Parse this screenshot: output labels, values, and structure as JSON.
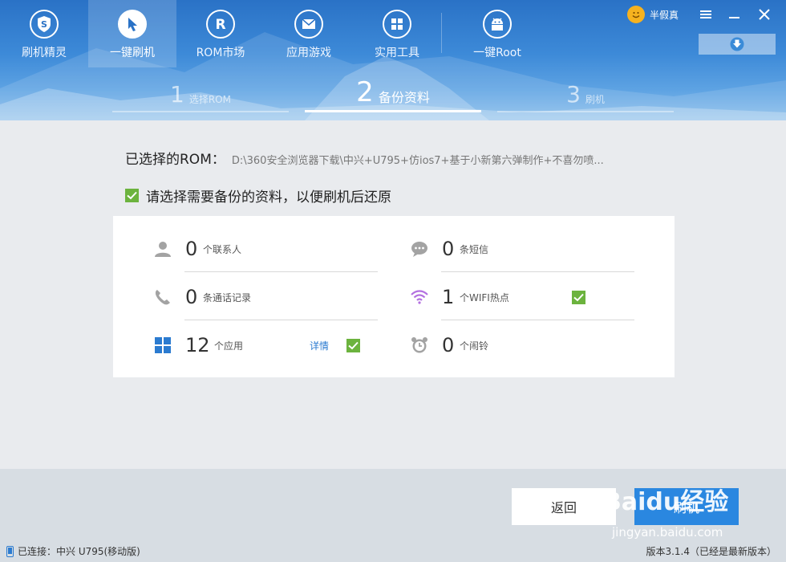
{
  "nav": {
    "items": [
      {
        "label": "刷机精灵",
        "icon": "shield-s-icon"
      },
      {
        "label": "一键刷机",
        "icon": "cursor-icon"
      },
      {
        "label": "ROM市场",
        "icon": "rom-r-icon"
      },
      {
        "label": "应用游戏",
        "icon": "mail-icon"
      },
      {
        "label": "实用工具",
        "icon": "grid-tools-icon"
      },
      {
        "label": "一键Root",
        "icon": "android-icon"
      }
    ],
    "active_index": 1
  },
  "user": {
    "name": "半假真",
    "avatar": "smiley-icon"
  },
  "window_controls": [
    "menu-icon",
    "minimize-icon",
    "close-icon"
  ],
  "download_button": {
    "icon": "download-icon"
  },
  "steps": [
    {
      "num": "1",
      "label": "选择ROM"
    },
    {
      "num": "2",
      "label": "备份资料"
    },
    {
      "num": "3",
      "label": "刷机"
    }
  ],
  "rom": {
    "label": "已选择的ROM：",
    "path": "D:\\360安全浏览器下载\\中兴+U795+仿ios7+基于小新第六弹制作+不喜勿喷..."
  },
  "backup_check": {
    "label": "请选择需要备份的资料，以便刷机后还原",
    "checked": true
  },
  "backup_items": [
    {
      "count": "0",
      "label": "个联系人",
      "icon": "person-icon",
      "checked": false
    },
    {
      "count": "0",
      "label": "条短信",
      "icon": "chat-bubble-icon",
      "checked": false
    },
    {
      "count": "0",
      "label": "条通话记录",
      "icon": "phone-icon",
      "checked": false
    },
    {
      "count": "1",
      "label": "个WIFI热点",
      "icon": "wifi-icon",
      "checked": true
    },
    {
      "count": "12",
      "label": "个应用",
      "icon": "apps-icon",
      "checked": true,
      "detail": "详情"
    },
    {
      "count": "0",
      "label": "个闹铃",
      "icon": "alarm-clock-icon",
      "checked": false
    }
  ],
  "buttons": {
    "back": "返回",
    "flash": "刷机"
  },
  "status": {
    "connected": "已连接：中兴 U795(移动版)",
    "version": "版本3.1.4（已经是最新版本）"
  },
  "watermark": {
    "brand": "Baidu经验",
    "url": "jingyan.baidu.com"
  },
  "colors": {
    "accent": "#2a87e0",
    "check": "#6cb33e",
    "header": "#2a72c6"
  }
}
